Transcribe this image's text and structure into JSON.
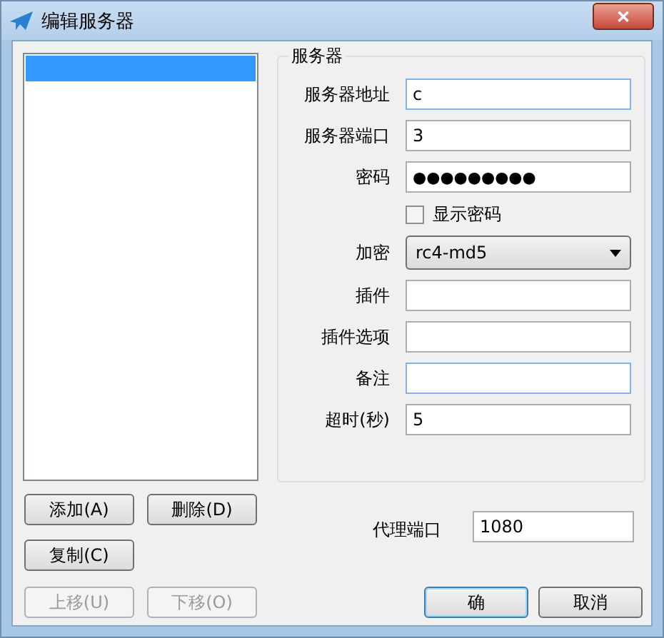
{
  "window": {
    "title": "编辑服务器",
    "close": "✕"
  },
  "server_list": {
    "items": [
      {
        "selected": true
      }
    ]
  },
  "server_group": {
    "title": "服务器",
    "fields": [
      {
        "kind": "text",
        "label": "服务器地址",
        "value": "c",
        "focused": true
      },
      {
        "kind": "text",
        "label": "服务器端口",
        "value": "3",
        "focused": false
      },
      {
        "kind": "password",
        "label": "密码",
        "value": "●●●●●●●●●",
        "focused": false
      },
      {
        "kind": "checkbox",
        "label": "显示密码",
        "checked": false
      },
      {
        "kind": "select",
        "label": "加密",
        "value": "rc4-md5"
      },
      {
        "kind": "text",
        "label": "插件",
        "focused": false
      },
      {
        "kind": "text",
        "label": "插件选项",
        "focused": false
      },
      {
        "kind": "text",
        "label": "备注",
        "focused": true
      },
      {
        "kind": "text",
        "label": "超时(秒)",
        "value": "5",
        "focused": false
      }
    ]
  },
  "list_buttons": [
    {
      "label": "添加(A)",
      "disabled": false
    },
    {
      "label": "删除(D)",
      "disabled": false
    },
    {
      "label": "复制(C)",
      "disabled": false
    },
    {
      "label": "上移(U)",
      "disabled": true
    },
    {
      "label": "下移(O)",
      "disabled": true
    }
  ],
  "proxy_port": {
    "label": "代理端口",
    "value": "1080"
  },
  "dialog_buttons": [
    {
      "label": "确",
      "default": true
    },
    {
      "label": "取消",
      "default": false
    }
  ]
}
